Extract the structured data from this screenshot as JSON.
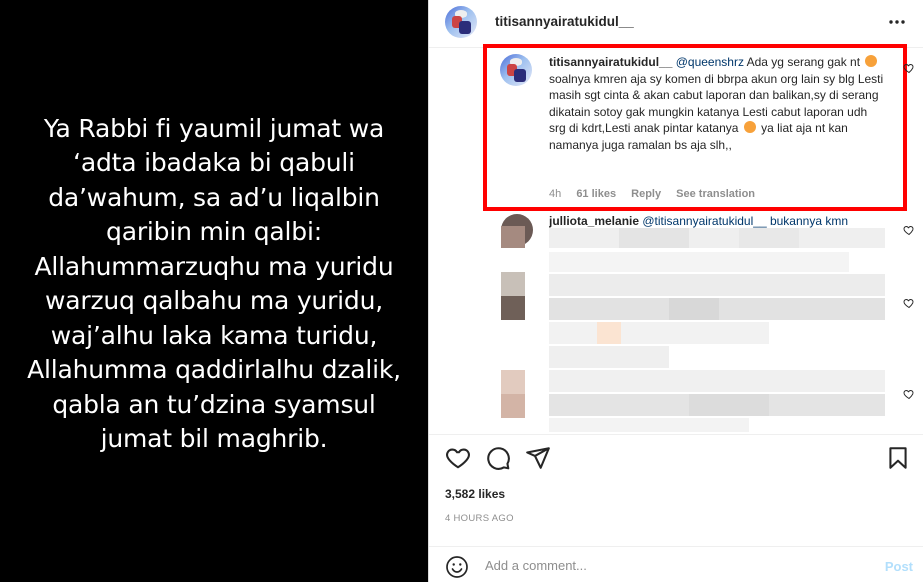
{
  "story": {
    "caption": "Ya Rabbi fi yaumil jumat wa ‘adta ibadaka bi qabuli da’wahum, sa ad’u liqalbin qaribin min qalbi: Allahummarzuqhu ma yuridu warzuq qalbahu ma yuridu, waj’alhu laka kama turidu, Allahumma qaddirlalhu dzalik, qabla an tu’dzina syamsul jumat bil maghrib."
  },
  "post": {
    "username": "titisannyairatukidul__",
    "more_icon": "more-horizontal-icon"
  },
  "highlighted_comment": {
    "username": "titisannyairatukidul__",
    "mention": "@queenshrz",
    "text_part1": "Ada yg serang gak nt",
    "text_part2": "soalnya kmren aja sy komen di bbrpa akun org lain sy blg Lesti masih sgt cinta & akan cabut laporan dan balikan,sy di serang dikatain sotoy gak mungkin katanya Lesti cabut laporan udh srg di kdrt,Lesti anak pintar katanya",
    "text_part3": "ya liat aja nt kan namanya juga ramalan bs aja slh,,",
    "emoji_icon": "face-with-hand-over-mouth-emoji",
    "time": "4h",
    "likes": "61 likes",
    "reply_label": "Reply",
    "translate_label": "See translation",
    "highlight_color": "#ff0000"
  },
  "next_comment": {
    "username": "julliota_melanie",
    "text": "@titisannyairatukidul__ bukannya kmn"
  },
  "actions": {
    "like_icon": "heart-icon",
    "comment_icon": "comment-bubble-icon",
    "share_icon": "paper-plane-icon",
    "save_icon": "bookmark-icon"
  },
  "likes_count": "3,582 likes",
  "timestamp": "4 HOURS AGO",
  "add_comment": {
    "placeholder": "Add a comment...",
    "post_label": "Post",
    "emoji_icon": "smiley-face-icon"
  }
}
